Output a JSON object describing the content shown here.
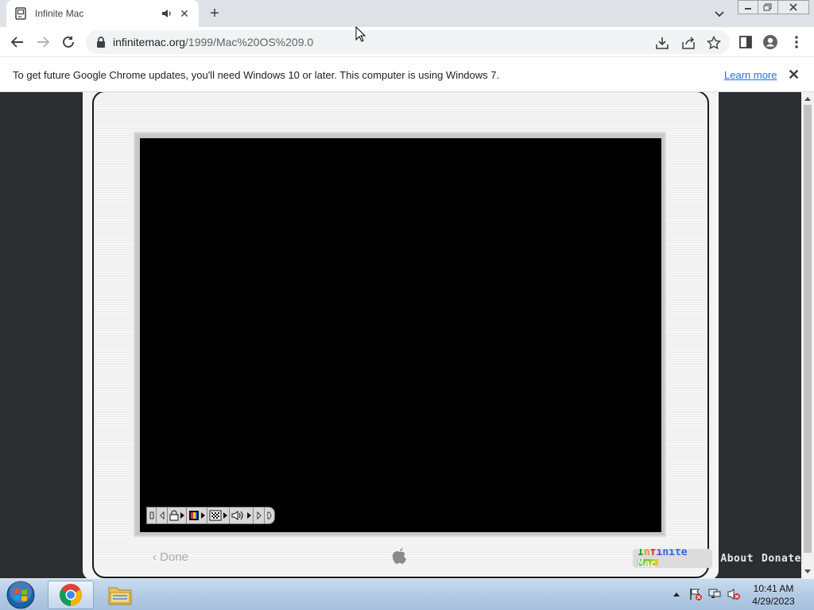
{
  "browser": {
    "tab": {
      "title": "Infinite Mac",
      "close_glyph": "✕"
    },
    "newtab_glyph": "+",
    "url_host": "infinitemac.org",
    "url_path": "/1999/Mac%20OS%209.0",
    "infobar": {
      "message": "To get future Google Chrome updates, you'll need Windows 10 or later. This computer is using Windows 7.",
      "link": "Learn more",
      "close_glyph": "✕"
    }
  },
  "emulator": {
    "done_label": "‹ Done",
    "logo_text": "Infinite Mac",
    "about_label": "About",
    "donate_label": "Donate"
  },
  "taskbar": {
    "time": "10:41 AM",
    "date": "4/29/2023"
  },
  "colors": {
    "page_bg": "#2b2d31",
    "monitor_bg": "#f4f4f4",
    "link_blue": "#1a73e8"
  }
}
